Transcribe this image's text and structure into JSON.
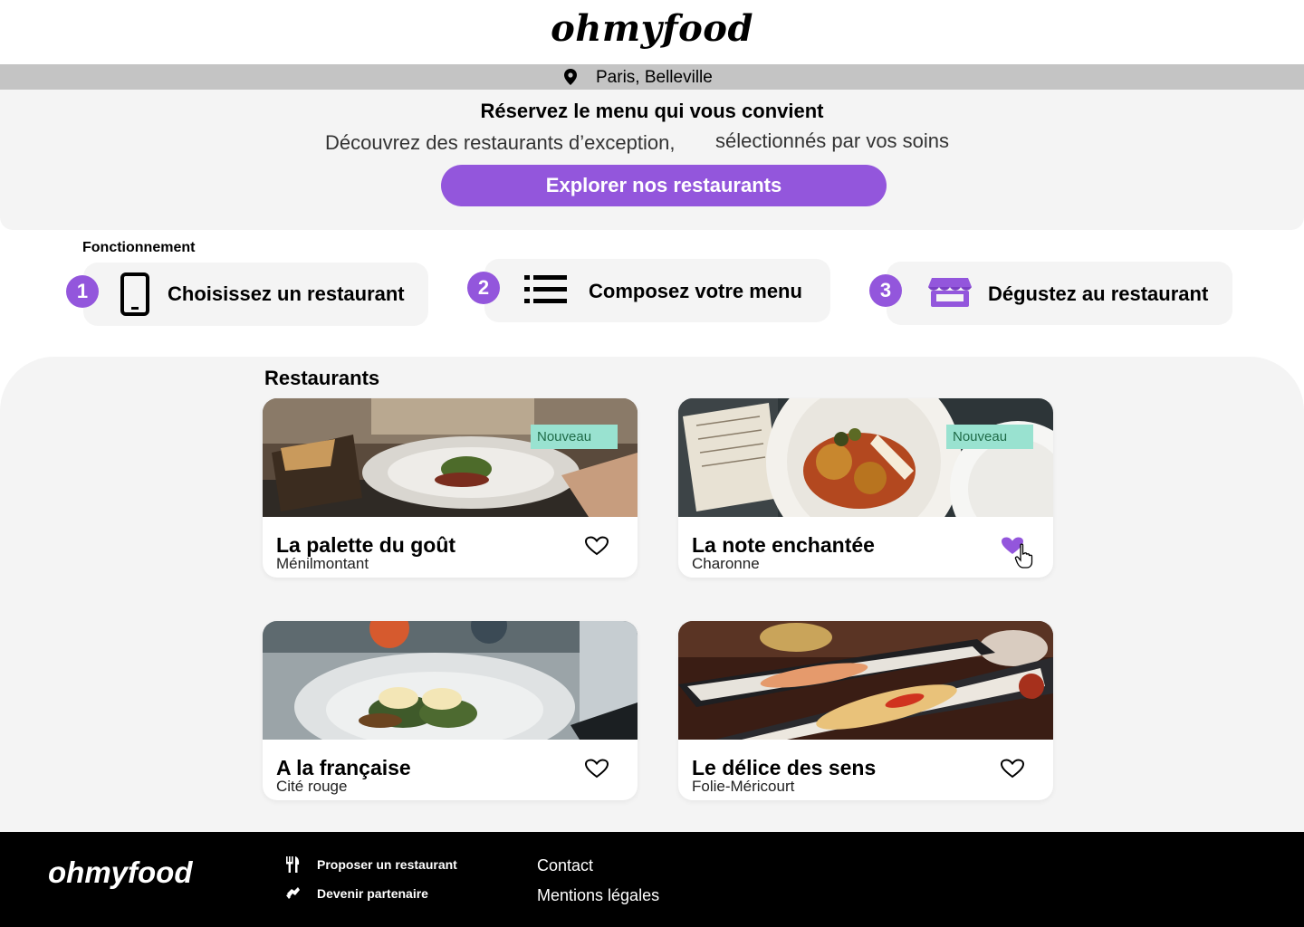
{
  "brand": {
    "logo": "ohmyfood",
    "accent_color": "#9356dc",
    "badge_color": "#99e2d0"
  },
  "location": {
    "icon": "map-pin-icon",
    "text": "Paris, Belleville"
  },
  "hero": {
    "title": "Réservez le menu qui  vous convient",
    "subtitle_part1": "Découvrez des restaurants d’exception,",
    "subtitle_part2": "sélectionnés par vos soins",
    "cta_label": "Explorer nos restaurants"
  },
  "how_it_works": {
    "heading": "Fonctionnement",
    "steps": [
      {
        "number": "1",
        "icon": "smartphone-icon",
        "label": "Choisissez un restaurant"
      },
      {
        "number": "2",
        "icon": "list-icon",
        "label": "Composez votre menu"
      },
      {
        "number": "3",
        "icon": "store-icon",
        "label": "Dégustez au restaurant"
      }
    ]
  },
  "restaurants": {
    "heading": "Restaurants",
    "items": [
      {
        "name": "La palette du goût",
        "area": "Ménilmontant",
        "badge": "Nouveau",
        "liked": false
      },
      {
        "name": "La note enchantée",
        "area": "Charonne",
        "badge": "Nouveau",
        "liked": true
      },
      {
        "name": "A la française",
        "area": "Cité rouge",
        "liked": false
      },
      {
        "name": "Le délice des sens",
        "area": "Folie-Méricourt",
        "liked": false
      }
    ]
  },
  "footer": {
    "logo": "ohmyfood",
    "links_col1": [
      {
        "icon": "utensils-icon",
        "label": "Proposer un restaurant"
      },
      {
        "icon": "handshake-icon",
        "label": "Devenir partenaire"
      }
    ],
    "links_col2": [
      {
        "label": "Contact"
      },
      {
        "label": "Mentions légales"
      }
    ]
  }
}
